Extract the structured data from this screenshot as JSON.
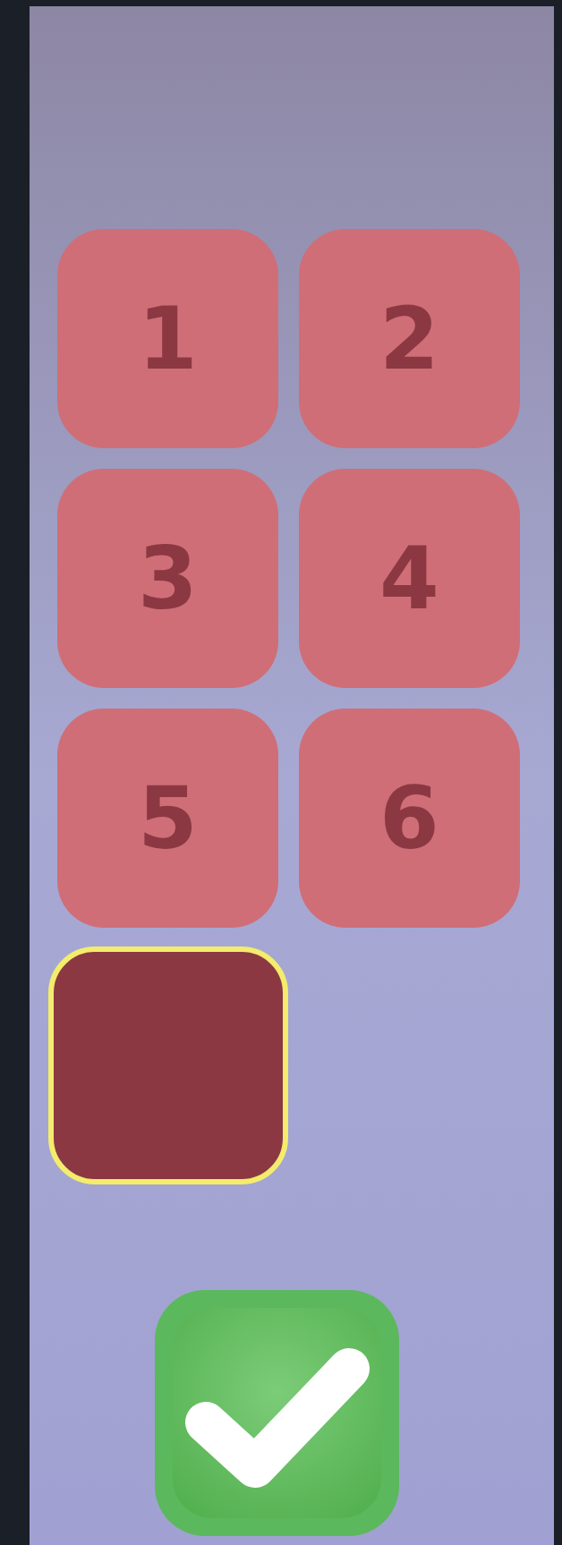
{
  "tiles": [
    {
      "label": "1",
      "selected": false
    },
    {
      "label": "2",
      "selected": false
    },
    {
      "label": "3",
      "selected": false
    },
    {
      "label": "4",
      "selected": false
    },
    {
      "label": "5",
      "selected": false
    },
    {
      "label": "6",
      "selected": false
    },
    {
      "selected": true
    }
  ]
}
